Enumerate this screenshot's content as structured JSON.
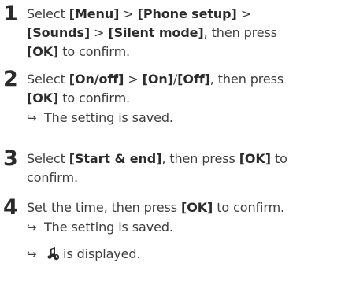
{
  "steps": [
    {
      "number": "1",
      "lines": [
        [
          "Select ",
          "[Menu]",
          " > ",
          "[Phone setup]",
          " >"
        ],
        [
          "[Sounds]",
          " > ",
          "[Silent mode]",
          ", then press"
        ],
        [
          "[OK]",
          " to confirm."
        ]
      ]
    },
    {
      "number": "2",
      "lines": [
        [
          "Select ",
          "[On/off]",
          " > ",
          "[On]",
          "/",
          "[Off]",
          ", then press"
        ],
        [
          "[OK]",
          " to confirm."
        ]
      ],
      "results": [
        "The setting is saved."
      ]
    },
    {
      "number": "3",
      "lines": [
        [
          "Select ",
          "[Start & end]",
          ", then press ",
          "[OK]",
          " to"
        ],
        [
          "confirm."
        ]
      ]
    },
    {
      "number": "4",
      "lines": [
        [
          "Set the time, then press ",
          "[OK]",
          " to confirm."
        ]
      ],
      "results": [
        "The setting is saved.",
        "is displayed."
      ]
    }
  ],
  "icons": {
    "result_arrow": "right-arrow-icon",
    "silent_mode": "silent-mode-icon"
  },
  "colors": {
    "text": "#3d3d3d",
    "emphasis": "#2b2b2b"
  }
}
